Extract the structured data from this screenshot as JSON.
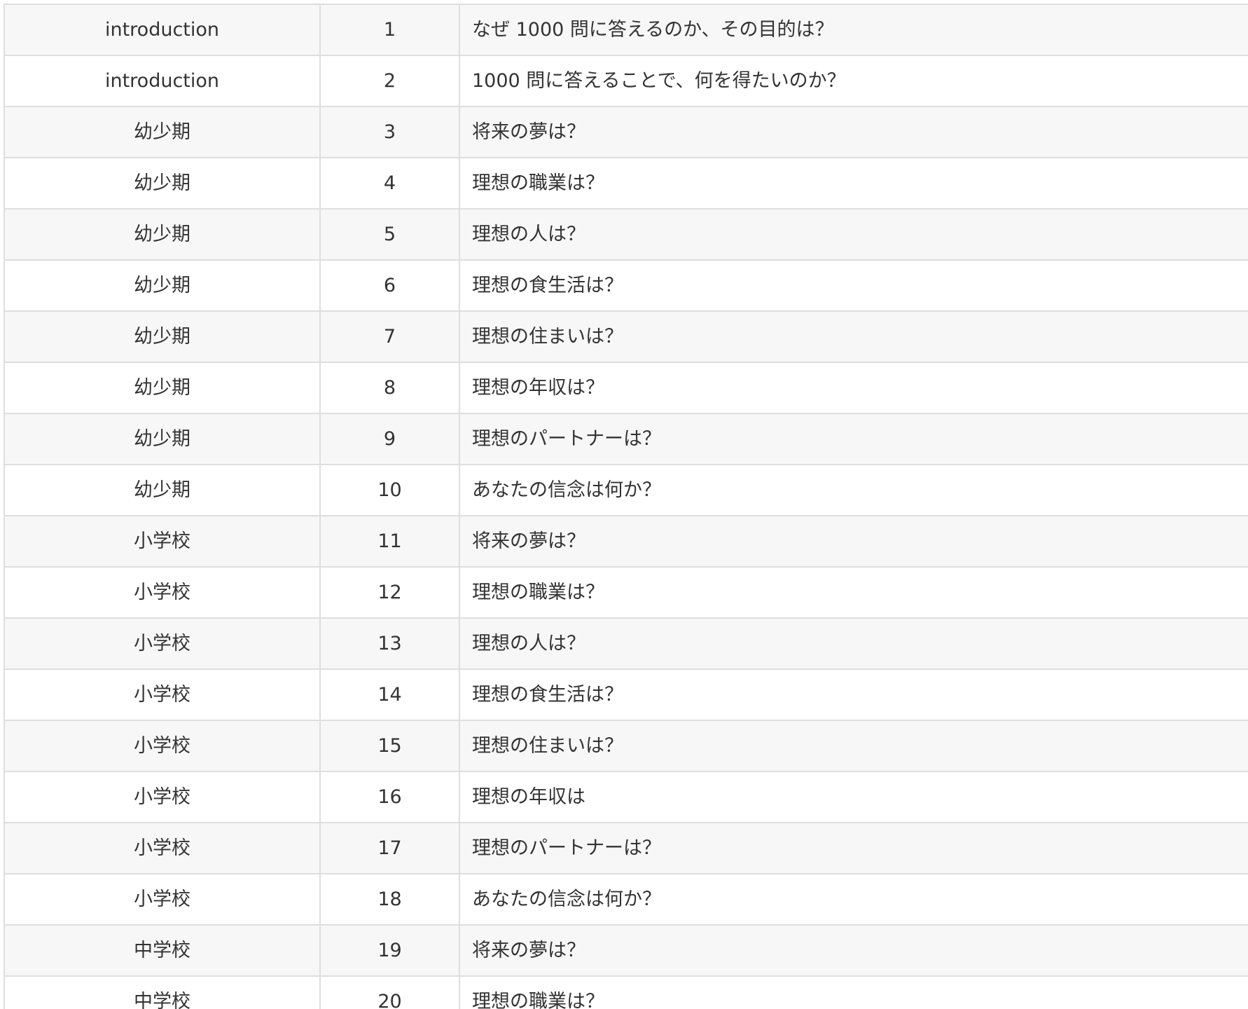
{
  "table": {
    "rows": [
      {
        "category": "introduction",
        "number": "1",
        "question": "なぜ 1000 問に答えるのか、その目的は？"
      },
      {
        "category": "introduction",
        "number": "2",
        "question": "1000 問に答えることで、何を得たいのか？"
      },
      {
        "category": "幼少期",
        "number": "3",
        "question": "将来の夢は？"
      },
      {
        "category": "幼少期",
        "number": "4",
        "question": "理想の職業は？"
      },
      {
        "category": "幼少期",
        "number": "5",
        "question": "理想の人は？"
      },
      {
        "category": "幼少期",
        "number": "6",
        "question": "理想の食生活は？"
      },
      {
        "category": "幼少期",
        "number": "7",
        "question": "理想の住まいは？"
      },
      {
        "category": "幼少期",
        "number": "8",
        "question": "理想の年収は？"
      },
      {
        "category": "幼少期",
        "number": "9",
        "question": "理想のパートナーは？"
      },
      {
        "category": "幼少期",
        "number": "10",
        "question": "あなたの信念は何か？"
      },
      {
        "category": "小学校",
        "number": "11",
        "question": "将来の夢は？"
      },
      {
        "category": "小学校",
        "number": "12",
        "question": "理想の職業は？"
      },
      {
        "category": "小学校",
        "number": "13",
        "question": "理想の人は？"
      },
      {
        "category": "小学校",
        "number": "14",
        "question": "理想の食生活は？"
      },
      {
        "category": "小学校",
        "number": "15",
        "question": "理想の住まいは？"
      },
      {
        "category": "小学校",
        "number": "16",
        "question": "理想の年収は"
      },
      {
        "category": "小学校",
        "number": "17",
        "question": "理想のパートナーは？"
      },
      {
        "category": "小学校",
        "number": "18",
        "question": "あなたの信念は何か？"
      },
      {
        "category": "中学校",
        "number": "19",
        "question": "将来の夢は？"
      },
      {
        "category": "中学校",
        "number": "20",
        "question": "理想の職業は？"
      }
    ]
  }
}
